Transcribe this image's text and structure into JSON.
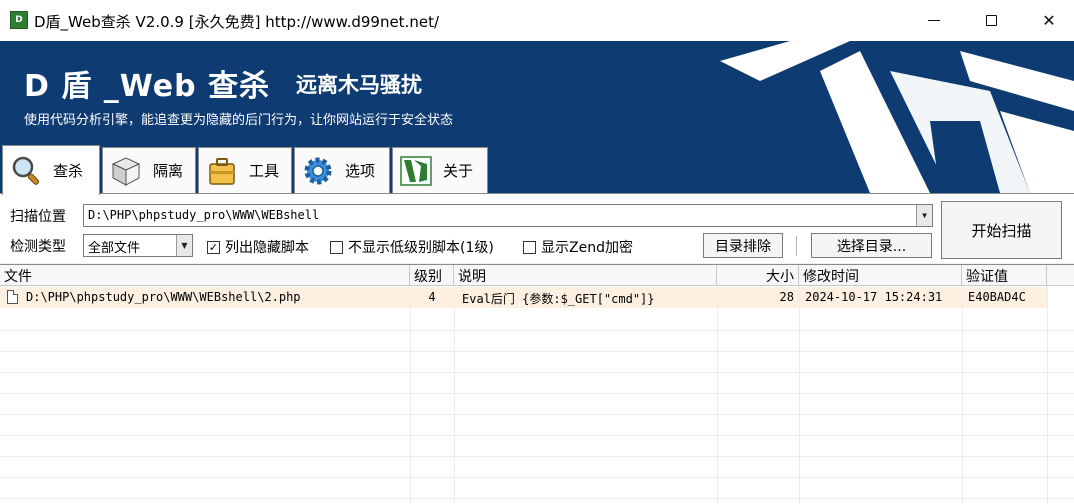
{
  "window": {
    "icon_text": "D",
    "title": "D盾_Web查杀 V2.0.9 [永久免费] http://www.d99net.net/"
  },
  "banner": {
    "title": "D 盾 _Web 查杀",
    "subtitle": "远离木马骚扰",
    "description": "使用代码分析引擎，能追查更为隐藏的后门行为，让你网站运行于安全状态"
  },
  "tabs": [
    {
      "label": "查杀",
      "icon": "magnifier-icon",
      "active": true
    },
    {
      "label": "隔离",
      "icon": "box-icon",
      "active": false
    },
    {
      "label": "工具",
      "icon": "toolbox-icon",
      "active": false
    },
    {
      "label": "选项",
      "icon": "gear-icon",
      "active": false
    },
    {
      "label": "关于",
      "icon": "d-logo-icon",
      "active": false
    }
  ],
  "controls": {
    "scan_location_label": "扫描位置",
    "scan_path": "D:\\PHP\\phpstudy_pro\\WWW\\WEBshell",
    "detect_type_label": "检测类型",
    "detect_type_value": "全部文件",
    "checkboxes": [
      {
        "label": "列出隐藏脚本",
        "checked": true
      },
      {
        "label": "不显示低级别脚本(1级)",
        "checked": false
      },
      {
        "label": "显示Zend加密",
        "checked": false
      }
    ],
    "exclude_button": "目录排除",
    "choose_dir_button": "选择目录...",
    "start_button": "开始扫描"
  },
  "table": {
    "columns": [
      "文件",
      "级别",
      "说明",
      "大小",
      "修改时间",
      "验证值"
    ],
    "rows": [
      {
        "file": "D:\\PHP\\phpstudy_pro\\WWW\\WEBshell\\2.php",
        "level": "4",
        "desc": "Eval后门 {参数:$_GET[\"cmd\"]}",
        "size": "28",
        "mtime": "2024-10-17 15:24:31",
        "hash": "E40BAD4C"
      }
    ]
  },
  "colors": {
    "banner": "#0f3b73",
    "row_highlight": "#fdf0e1"
  }
}
